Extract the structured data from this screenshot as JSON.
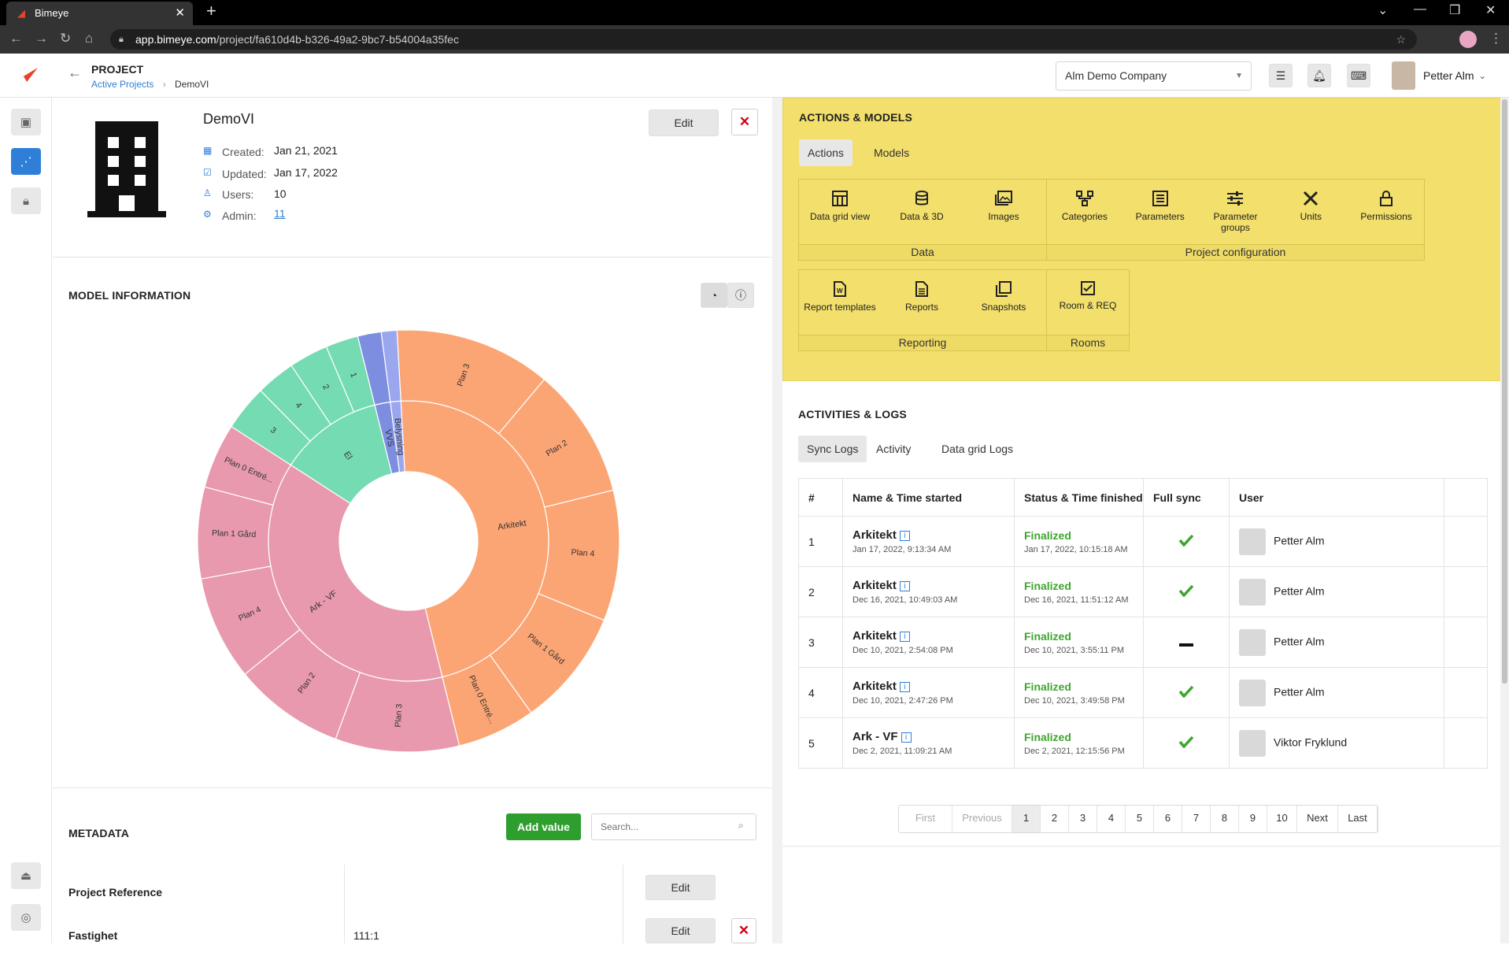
{
  "browser": {
    "tab_title": "Bimeye",
    "url_domain": "app.bimeye.com",
    "url_path": "/project/fa610d4b-b326-49a2-9bc7-b54004a35fec"
  },
  "header": {
    "section": "PROJECT",
    "breadcrumb_parent": "Active Projects",
    "breadcrumb_current": "DemoVI",
    "company": "Alm Demo Company",
    "user_name": "Petter Alm"
  },
  "project": {
    "name": "DemoVI",
    "edit_label": "Edit",
    "created_label": "Created:",
    "created": "Jan 21, 2021",
    "updated_label": "Updated:",
    "updated": "Jan 17, 2022",
    "users_label": "Users:",
    "users": "10",
    "admin_label": "Admin:",
    "admin": "11"
  },
  "model_info": {
    "title": "MODEL INFORMATION"
  },
  "chart_data": {
    "type": "sunburst",
    "inner_ring": [
      {
        "label": "Arkitekt",
        "value": 47.0,
        "color": "#fca574"
      },
      {
        "label": "Ark - VF",
        "value": 38.0,
        "color": "#e899ad"
      },
      {
        "label": "El",
        "value": 12.0,
        "color": "#75dbb2"
      },
      {
        "label": "VVS",
        "value": 1.8,
        "color": "#7d8ee0"
      },
      {
        "label": "Belysning",
        "value": 1.2,
        "color": "#9aa7ee"
      }
    ],
    "outer_ring": [
      {
        "label": "Plan 3",
        "parent": "Arkitekt",
        "value": 12.0,
        "color": "#fca574"
      },
      {
        "label": "Plan 2",
        "parent": "Arkitekt",
        "value": 10.0,
        "color": "#fca574"
      },
      {
        "label": "Plan 4",
        "parent": "Arkitekt",
        "value": 10.0,
        "color": "#fca574"
      },
      {
        "label": "Plan 1 Gård",
        "parent": "Arkitekt",
        "value": 9.0,
        "color": "#fca574"
      },
      {
        "label": "Plan 0 Entré...",
        "parent": "Arkitekt",
        "value": 6.0,
        "color": "#fca574"
      },
      {
        "label": "Plan 3",
        "parent": "Ark - VF",
        "value": 9.5,
        "color": "#e899ad"
      },
      {
        "label": "Plan 2",
        "parent": "Ark - VF",
        "value": 8.5,
        "color": "#e899ad"
      },
      {
        "label": "Plan 4",
        "parent": "Ark - VF",
        "value": 8.0,
        "color": "#e899ad"
      },
      {
        "label": "Plan 1 Gård",
        "parent": "Ark - VF",
        "value": 7.0,
        "color": "#e899ad"
      },
      {
        "label": "Plan 0 Entré...",
        "parent": "Ark - VF",
        "value": 5.0,
        "color": "#e899ad"
      },
      {
        "label": "3",
        "parent": "El",
        "value": 3.5,
        "color": "#75dbb2"
      },
      {
        "label": "4",
        "parent": "El",
        "value": 3.0,
        "color": "#75dbb2"
      },
      {
        "label": "2",
        "parent": "El",
        "value": 3.0,
        "color": "#75dbb2"
      },
      {
        "label": "1",
        "parent": "El",
        "value": 2.5,
        "color": "#75dbb2"
      },
      {
        "label": "",
        "parent": "VVS",
        "value": 1.8,
        "color": "#7d8ee0"
      },
      {
        "label": "",
        "parent": "Belysning",
        "value": 1.2,
        "color": "#9aa7ee"
      }
    ]
  },
  "metadata": {
    "title": "METADATA",
    "add_label": "Add value",
    "search_placeholder": "Search...",
    "rows": [
      {
        "label": "Project Reference",
        "value": "",
        "edit": "Edit"
      },
      {
        "label": "Fastighet",
        "value": "111:1",
        "edit": "Edit"
      }
    ]
  },
  "actions": {
    "title": "ACTIONS & MODELS",
    "tabs": [
      "Actions",
      "Models"
    ],
    "groups": [
      {
        "label": "Data",
        "items": [
          {
            "label": "Data grid view",
            "icon": "grid-icon"
          },
          {
            "label": "Data & 3D",
            "icon": "database-icon"
          },
          {
            "label": "Images",
            "icon": "images-icon"
          }
        ]
      },
      {
        "label": "Project configuration",
        "items": [
          {
            "label": "Categories",
            "icon": "categories-icon"
          },
          {
            "label": "Parameters",
            "icon": "list-icon"
          },
          {
            "label": "Parameter groups",
            "icon": "sliders-icon"
          },
          {
            "label": "Units",
            "icon": "ruler-icon"
          },
          {
            "label": "Permissions",
            "icon": "lock-icon"
          }
        ]
      },
      {
        "label": "Reporting",
        "items": [
          {
            "label": "Report templates",
            "icon": "word-file-icon"
          },
          {
            "label": "Reports",
            "icon": "report-icon"
          },
          {
            "label": "Snapshots",
            "icon": "snapshot-icon"
          }
        ]
      },
      {
        "label": "Rooms",
        "items": [
          {
            "label": "Room & REQ",
            "icon": "checkbox-icon"
          }
        ]
      }
    ]
  },
  "activities": {
    "title": "ACTIVITIES & LOGS",
    "tabs": [
      "Sync Logs",
      "Activity",
      "Data grid Logs"
    ],
    "columns": [
      "#",
      "Name & Time started",
      "Status & Time finished",
      "Full sync",
      "User"
    ],
    "rows": [
      {
        "num": "1",
        "name": "Arkitekt",
        "started": "Jan 17, 2022, 9:13:34 AM",
        "status": "Finalized",
        "finished": "Jan 17, 2022, 10:15:18 AM",
        "full_sync": "yes",
        "user": "Petter Alm"
      },
      {
        "num": "2",
        "name": "Arkitekt",
        "started": "Dec 16, 2021, 10:49:03 AM",
        "status": "Finalized",
        "finished": "Dec 16, 2021, 11:51:12 AM",
        "full_sync": "yes",
        "user": "Petter Alm"
      },
      {
        "num": "3",
        "name": "Arkitekt",
        "started": "Dec 10, 2021, 2:54:08 PM",
        "status": "Finalized",
        "finished": "Dec 10, 2021, 3:55:11 PM",
        "full_sync": "no",
        "user": "Petter Alm"
      },
      {
        "num": "4",
        "name": "Arkitekt",
        "started": "Dec 10, 2021, 2:47:26 PM",
        "status": "Finalized",
        "finished": "Dec 10, 2021, 3:49:58 PM",
        "full_sync": "yes",
        "user": "Petter Alm"
      },
      {
        "num": "5",
        "name": "Ark - VF",
        "started": "Dec 2, 2021, 11:09:21 AM",
        "status": "Finalized",
        "finished": "Dec 2, 2021, 12:15:56 PM",
        "full_sync": "yes",
        "user": "Viktor Fryklund"
      }
    ],
    "pagination": [
      "First",
      "Previous",
      "1",
      "2",
      "3",
      "4",
      "5",
      "6",
      "7",
      "8",
      "9",
      "10",
      "Next",
      "Last"
    ],
    "current_page": "1"
  }
}
